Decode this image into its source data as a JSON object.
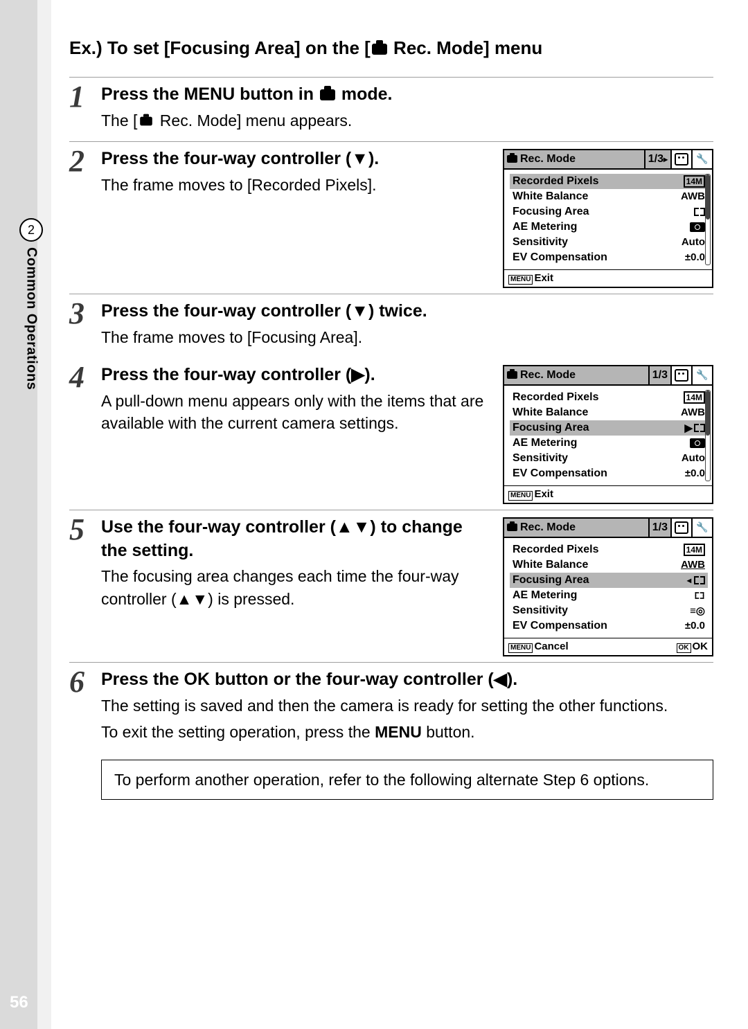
{
  "page_number": "56",
  "side_tab": {
    "number": "2",
    "label": "Common Operations"
  },
  "heading": {
    "prefix": "Ex.) To set [Focusing Area] on the [",
    "after_icon": " Rec. Mode] menu"
  },
  "steps": [
    {
      "num": "1",
      "title_before": "Press the ",
      "title_menu": "MENU",
      "title_mid": " button in ",
      "title_after": " mode.",
      "body_before": "The [",
      "body_after": " Rec. Mode] menu appears."
    },
    {
      "num": "2",
      "title": "Press the four-way controller (▼).",
      "body": "The frame moves to [Recorded Pixels]."
    },
    {
      "num": "3",
      "title": "Press the four-way controller (▼) twice.",
      "body": "The frame moves to [Focusing Area]."
    },
    {
      "num": "4",
      "title": "Press the four-way controller (▶).",
      "body": "A pull-down menu appears only with the items that are available with the current camera settings."
    },
    {
      "num": "5",
      "title": "Use the four-way controller (▲▼) to change the setting.",
      "body": "The focusing area changes each time the four-way controller (▲▼) is pressed."
    },
    {
      "num": "6",
      "title_before": "Press the ",
      "title_ok": "OK",
      "title_after": " button or the four-way controller (◀).",
      "body1": "The setting is saved and then the camera is ready for setting the other functions.",
      "body2_before": "To exit the setting operation, press the ",
      "body2_menu": "MENU",
      "body2_after": " button."
    }
  ],
  "note": "To perform another operation, refer to the following alternate Step 6 options.",
  "lcd_common": {
    "title": "Rec. Mode",
    "page": "1/3",
    "rows": {
      "recorded_pixels": "Recorded Pixels",
      "white_balance": "White Balance",
      "focusing_area": "Focusing Area",
      "ae_metering": "AE Metering",
      "sensitivity": "Sensitivity",
      "ev_comp": "EV Compensation"
    },
    "vals": {
      "px": "14M",
      "awb": "AWB",
      "auto": "Auto",
      "ev": "±0.0"
    },
    "foot_menu": "MENU",
    "foot_exit": "Exit",
    "foot_cancel": "Cancel",
    "foot_ok_box": "OK",
    "foot_ok": "OK"
  }
}
